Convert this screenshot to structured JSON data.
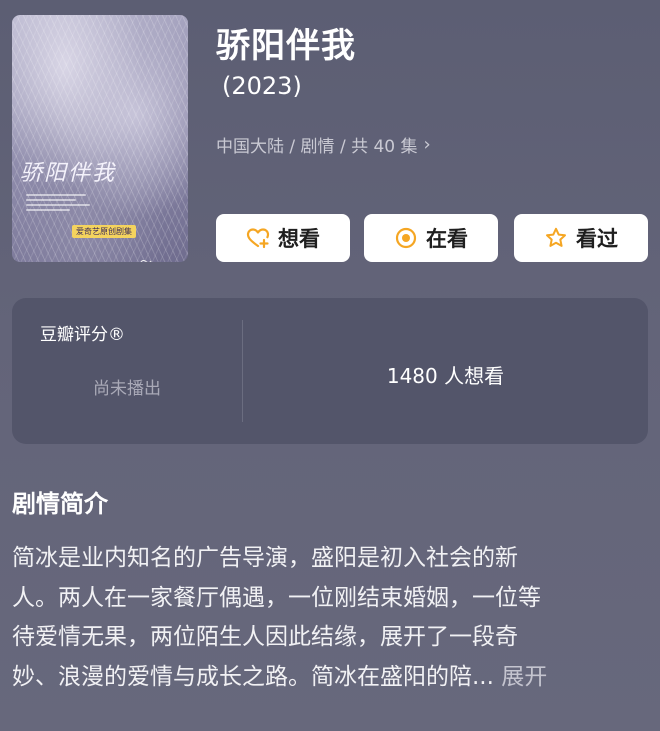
{
  "poster": {
    "title_art": "骄阳伴我",
    "platform": "爱奇艺原创剧集"
  },
  "show": {
    "title": "骄阳伴我",
    "year": "(2023)",
    "meta": "中国大陆 / 剧情 / 共 40 集",
    "meta_chevron": "›"
  },
  "actions": [
    {
      "label": "想看",
      "icon": "heart-plus-icon"
    },
    {
      "label": "在看",
      "icon": "target-circle-icon"
    },
    {
      "label": "看过",
      "icon": "star-icon"
    }
  ],
  "rating": {
    "label": "豆瓣评分®",
    "status": "尚未播出",
    "want_count": "1480 人想看"
  },
  "synopsis": {
    "heading": "剧情简介",
    "lines": [
      "简冰是业内知名的广告导演，盛阳是初入社会的新",
      "人。两人在一家餐厅偶遇，一位刚结束婚姻，一位等",
      "待爱情无果，两位陌生人因此结缘，展开了一段奇",
      "妙、浪漫的爱情与成长之路。简冰在盛阳的陪..."
    ],
    "expand_label": "展开"
  },
  "colors": {
    "accent_orange": "#f5a623",
    "background": "#5f6075",
    "card": "#53556a"
  }
}
